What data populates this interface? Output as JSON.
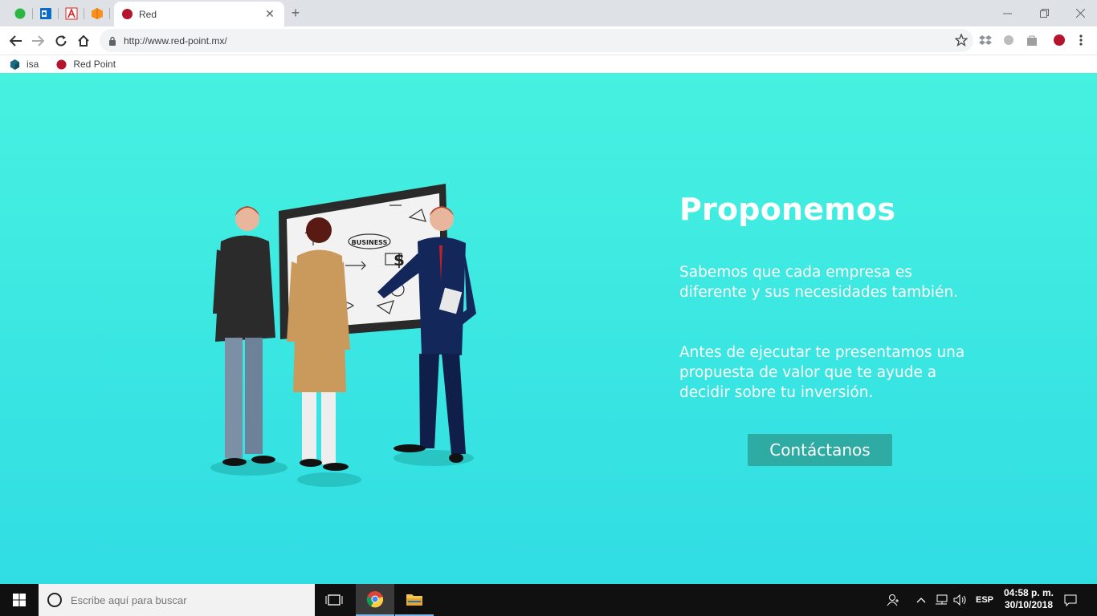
{
  "browser": {
    "pinned_tabs": [
      "whatsapp-icon",
      "outlook-icon",
      "adobe-icon",
      "box-icon"
    ],
    "active_tab": {
      "title": "Red"
    },
    "address": "http://www.red-point.mx/",
    "bookmarks": [
      {
        "label": "isa",
        "icon": "hexagon-icon"
      },
      {
        "label": "Red Point",
        "icon": "redpoint-icon"
      }
    ],
    "colors": {
      "tabstrip": "#dee1e6",
      "accent": "#b5142c"
    }
  },
  "page": {
    "heading": "Proponemos",
    "paragraph1": "Sabemos que cada empresa es diferente y sus necesidades también.",
    "paragraph2": "Antes de ejecutar te presentamos una propuesta de valor que te ayude a decidir sobre tu inversión.",
    "cta_label": "Contáctanos",
    "illustration_text": "BUSINESS",
    "colors": {
      "bg_top": "#47f1e0",
      "bg_bottom": "#30dde3",
      "button": "#2eaba3"
    }
  },
  "taskbar": {
    "search_placeholder": "Escribe aquí para buscar",
    "language": "ESP",
    "time": "04:58 p. m.",
    "date": "30/10/2018"
  }
}
